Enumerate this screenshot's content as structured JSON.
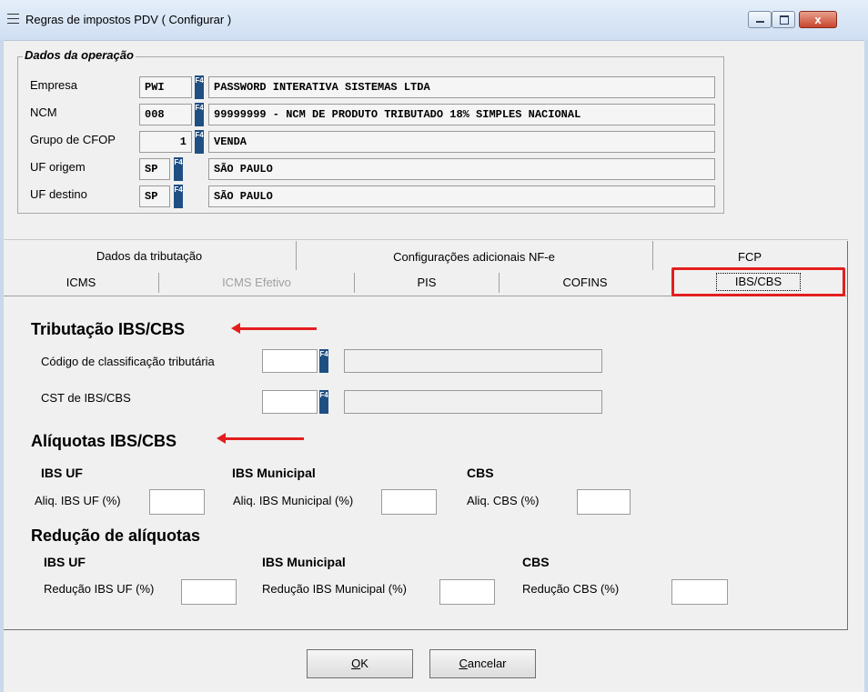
{
  "window": {
    "title": "Regras de impostos PDV ( Configurar )",
    "close_glyph": "x"
  },
  "operation": {
    "legend": "Dados da operação",
    "rows": [
      {
        "label": "Empresa",
        "code": "PWI",
        "description": "PASSWORD INTERATIVA SISTEMAS LTDA"
      },
      {
        "label": "NCM",
        "code": "008",
        "description": "99999999 - NCM DE PRODUTO TRIBUTADO 18% SIMPLES NACIONAL"
      },
      {
        "label": "Grupo de CFOP",
        "code": "1",
        "description": "VENDA"
      },
      {
        "label": "UF origem",
        "code": "SP",
        "description": "SÃO PAULO"
      },
      {
        "label": "UF destino",
        "code": "SP",
        "description": "SÃO PAULO"
      }
    ],
    "lookup_key": "F4"
  },
  "tabs_top": [
    "Dados da tributação",
    "Configurações adicionais NF-e",
    "FCP"
  ],
  "tabs_bottom": [
    "ICMS",
    "ICMS Efetivo",
    "PIS",
    "COFINS",
    "IBS/CBS"
  ],
  "active_tab": "IBS/CBS",
  "ibs_cbs": {
    "tributacao_title": "Tributação IBS/CBS",
    "class_code_label": "Código de classificação tributária",
    "cst_label": "CST de IBS/CBS",
    "aliquotas_title": "Alíquotas IBS/CBS",
    "aliquotas": [
      {
        "group": "IBS UF",
        "label": "Aliq. IBS UF (%)"
      },
      {
        "group": "IBS Municipal",
        "label": "Aliq. IBS Municipal (%)"
      },
      {
        "group": "CBS",
        "label": "Aliq. CBS (%)"
      }
    ],
    "reducao_title": "Redução de alíquotas",
    "reducoes": [
      {
        "group": "IBS UF",
        "label": "Redução IBS UF (%)"
      },
      {
        "group": "IBS Municipal",
        "label": "Redução IBS Municipal (%)"
      },
      {
        "group": "CBS",
        "label": "Redução CBS (%)"
      }
    ]
  },
  "buttons": {
    "ok_key": "O",
    "ok_rest": "K",
    "cancel_key": "C",
    "cancel_rest": "ancelar"
  },
  "colors": {
    "highlight": "#e41e1e",
    "f4_button": "#1f4f82"
  }
}
